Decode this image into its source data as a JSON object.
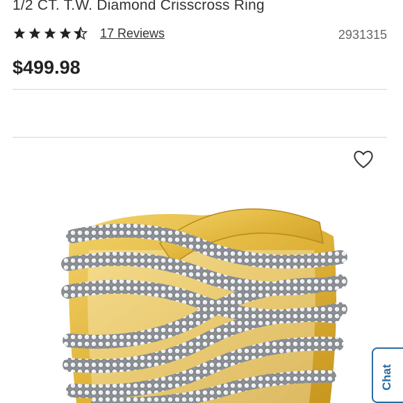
{
  "product": {
    "title": "1/2 CT. T.W. Diamond Crisscross Ring",
    "rating": 4.5,
    "reviews_label": "17 Reviews",
    "sku": "2931315",
    "price": "$499.98"
  },
  "icons": {
    "star": "star-icon",
    "favorite": "heart-outline-icon"
  },
  "chat": {
    "label": "Chat"
  },
  "colors": {
    "accent": "#2b6ca3",
    "gold": "#e0b43a",
    "text": "#222222"
  }
}
